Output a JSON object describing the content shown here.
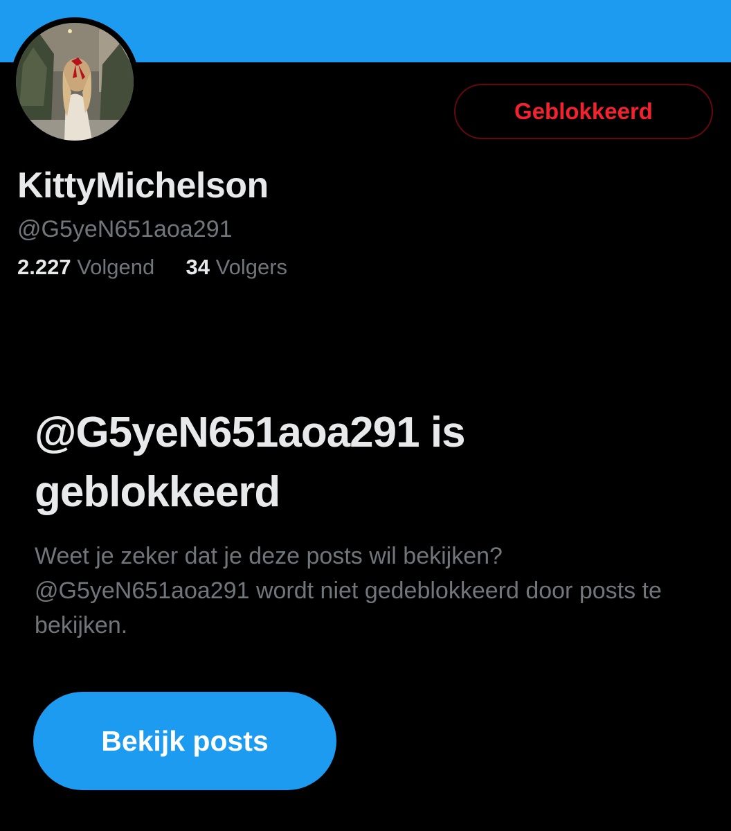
{
  "profile": {
    "display_name": "KittyMichelson",
    "handle": "@G5yeN651aoa291",
    "following_count": "2.227",
    "following_label": "Volgend",
    "followers_count": "34",
    "followers_label": "Volgers",
    "avatar_icon": "profile-photo"
  },
  "actions": {
    "blocked_label": "Geblokkeerd",
    "view_posts_label": "Bekijk posts"
  },
  "notice": {
    "title": "@G5yeN651aoa291 is geblokkeerd",
    "description": "Weet je zeker dat je deze posts wil bekijken? @G5yeN651aoa291 wordt niet gedeblokkeerd door posts te bekijken."
  },
  "colors": {
    "banner": "#1d9bf0",
    "background": "#000000",
    "primary_text": "#e7e9ea",
    "secondary_text": "#71767b",
    "blocked_red": "#f4212e",
    "blocked_border": "#67070f",
    "button_blue": "#1d9bf0"
  }
}
